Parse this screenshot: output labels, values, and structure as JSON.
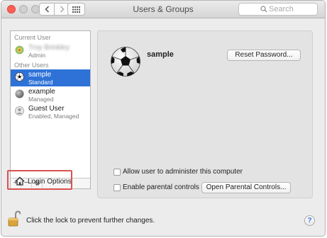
{
  "window": {
    "title": "Users & Groups",
    "search_placeholder": "Search"
  },
  "sidebar": {
    "current_user_label": "Current User",
    "current_user": {
      "name": "Troy Brinkley",
      "role": "Admin"
    },
    "other_users_label": "Other Users",
    "users": [
      {
        "name": "sample",
        "role": "Standard",
        "selected": true,
        "avatar": "soccer-ball"
      },
      {
        "name": "example",
        "role": "Managed",
        "selected": false,
        "avatar": "gray-ball"
      },
      {
        "name": "Guest User",
        "role": "Enabled, Managed",
        "selected": false,
        "avatar": "person-silhouette"
      }
    ],
    "login_options_label": "Login Options",
    "footer": {
      "add": "+",
      "remove": "−",
      "action": "gear-icon"
    }
  },
  "panel": {
    "user_name": "sample",
    "reset_password_label": "Reset Password...",
    "allow_admin_label": "Allow user to administer this computer",
    "enable_parental_label": "Enable parental controls",
    "open_parental_label": "Open Parental Controls..."
  },
  "footer": {
    "lock_text": "Click the lock to prevent further changes.",
    "help_label": "?"
  },
  "colors": {
    "selection": "#2e72d8",
    "highlight_box": "#d9534f"
  }
}
